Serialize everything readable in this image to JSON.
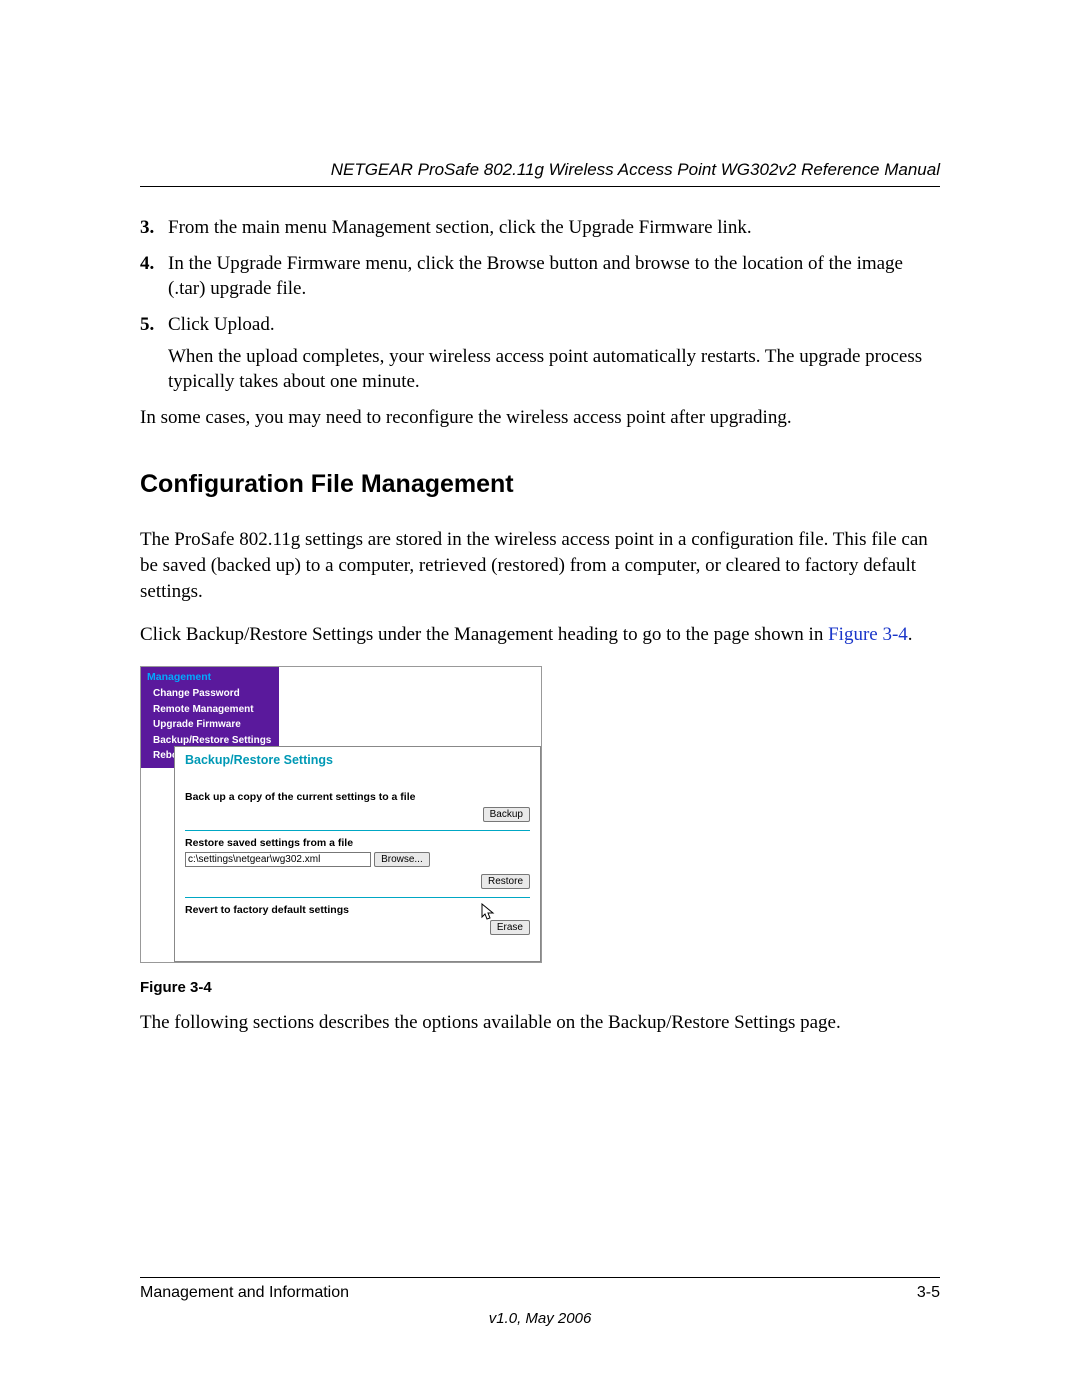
{
  "header": {
    "running_head": "NETGEAR ProSafe 802.11g Wireless Access Point WG302v2 Reference Manual"
  },
  "steps": {
    "items": [
      {
        "num": "3.",
        "text": "From the main menu Management section, click the Upgrade Firmware link."
      },
      {
        "num": "4.",
        "text": "In the Upgrade Firmware menu, click the Browse button and browse to the location of the image (.tar) upgrade file."
      },
      {
        "num": "5.",
        "text": "Click Upload.",
        "extra": "When the upload completes, your wireless access point automatically restarts. The upgrade process typically takes about one minute."
      }
    ],
    "after": "In some cases, you may need to reconfigure the wireless access point after upgrading."
  },
  "section": {
    "heading": "Configuration File Management",
    "p1": "The ProSafe 802.11g  settings are stored in the wireless access point in a configuration file. This file can be saved (backed up) to a computer, retrieved (restored) from a computer, or cleared to factory default settings.",
    "p2a": "Click Backup/Restore Settings under the Management heading to go to the page shown in ",
    "p2_link": "Figure 3-4",
    "p2b": "."
  },
  "figure": {
    "caption": "Figure 3-4",
    "management_header": "Management",
    "menu": {
      "change_password": "Change Password",
      "remote_management": "Remote Management",
      "upgrade_firmware": "Upgrade Firmware",
      "backup_restore": "Backup/Restore Settings",
      "reboot": "Rebo"
    },
    "panel": {
      "title": "Backup/Restore Settings",
      "backup_label": "Back up a copy of the current settings to a file",
      "backup_btn": "Backup",
      "restore_label": "Restore saved settings from a file",
      "restore_path": "c:\\settings\\netgear\\wg302.xml",
      "browse_btn": "Browse...",
      "restore_btn": "Restore",
      "revert_label": "Revert to factory default settings",
      "erase_btn": "Erase"
    }
  },
  "after_figure": "The following sections describes the options available on the Backup/Restore Settings page.",
  "footer": {
    "left": "Management and Information",
    "right": "3-5",
    "version": "v1.0, May 2006"
  }
}
